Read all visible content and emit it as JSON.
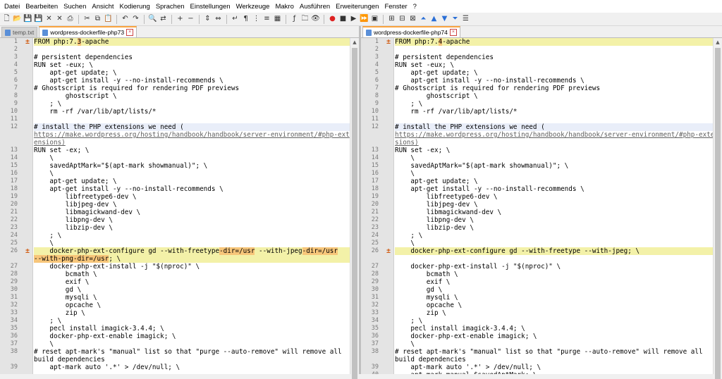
{
  "menu": [
    "Datei",
    "Bearbeiten",
    "Suchen",
    "Ansicht",
    "Kodierung",
    "Sprachen",
    "Einstellungen",
    "Werkzeuge",
    "Makro",
    "Ausführen",
    "Erweiterungen",
    "Fenster",
    "?"
  ],
  "toolbar_icons": [
    "new-file-icon",
    "open-file-icon",
    "save-icon",
    "save-all-icon",
    "close-icon",
    "close-all-icon",
    "print-icon",
    "cut-icon",
    "copy-icon",
    "paste-icon",
    "undo-icon",
    "redo-icon",
    "find-icon",
    "replace-icon",
    "zoom-in-icon",
    "zoom-out-icon",
    "sync-vertical-icon",
    "sync-horizontal-icon",
    "word-wrap-icon",
    "all-characters-icon",
    "indent-guide-icon",
    "lang-icon",
    "doc-map-icon",
    "function-list-icon",
    "folder-workspace-icon",
    "monitoring-icon",
    "record-macro-icon",
    "stop-record-icon",
    "play-macro-icon",
    "run-macro-multiple-icon",
    "save-macro-icon",
    "compare-icon",
    "compare-settings-icon",
    "clear-compare-icon",
    "first-diff-icon",
    "prev-diff-icon",
    "next-diff-icon",
    "last-diff-icon",
    "nav-bar-icon"
  ],
  "left": {
    "tabs": [
      {
        "label": "temp.txt",
        "active": false
      },
      {
        "label": "wordpress-dockerfile-php73",
        "active": true
      }
    ],
    "lines": [
      {
        "n": "1",
        "code": "FROM php:7.3-apache",
        "style": "hl",
        "mark": "+"
      },
      {
        "n": "2",
        "code": ""
      },
      {
        "n": "3",
        "code": "# persistent dependencies"
      },
      {
        "n": "4",
        "code": "RUN set -eux; \\"
      },
      {
        "n": "5",
        "code": "    apt-get update; \\"
      },
      {
        "n": "6",
        "code": "    apt-get install -y --no-install-recommends \\"
      },
      {
        "n": "7",
        "code": "# Ghostscript is required for rendering PDF previews"
      },
      {
        "n": "8",
        "code": "        ghostscript \\"
      },
      {
        "n": "9",
        "code": "    ; \\"
      },
      {
        "n": "10",
        "code": "    rm -rf /var/lib/apt/lists/*"
      },
      {
        "n": "11",
        "code": ""
      },
      {
        "n": "12",
        "code": "# install the PHP extensions we need (",
        "style": "sel"
      },
      {
        "n": "",
        "code": "https://make.wordpress.org/hosting/handbook/handbook/server-environment/#php-ext",
        "link": true
      },
      {
        "n": "",
        "code": "ensions)",
        "link": true
      },
      {
        "n": "13",
        "code": "RUN set -ex; \\"
      },
      {
        "n": "14",
        "code": "    \\"
      },
      {
        "n": "15",
        "code": "    savedAptMark=\"$(apt-mark showmanual)\"; \\"
      },
      {
        "n": "16",
        "code": "    \\"
      },
      {
        "n": "17",
        "code": "    apt-get update; \\"
      },
      {
        "n": "18",
        "code": "    apt-get install -y --no-install-recommends \\"
      },
      {
        "n": "19",
        "code": "        libfreetype6-dev \\"
      },
      {
        "n": "20",
        "code": "        libjpeg-dev \\"
      },
      {
        "n": "21",
        "code": "        libmagickwand-dev \\"
      },
      {
        "n": "22",
        "code": "        libpng-dev \\"
      },
      {
        "n": "23",
        "code": "        libzip-dev \\"
      },
      {
        "n": "24",
        "code": "    ; \\"
      },
      {
        "n": "25",
        "code": "    \\"
      },
      {
        "n": "26",
        "code": "    docker-php-ext-configure gd --with-freetype-dir=/usr --with-jpeg-dir=/usr",
        "style": "hl",
        "mark": "+"
      },
      {
        "n": "",
        "code": "--with-png-dir=/usr; \\",
        "style": "hl"
      },
      {
        "n": "27",
        "code": "    docker-php-ext-install -j \"$(nproc)\" \\"
      },
      {
        "n": "28",
        "code": "        bcmath \\"
      },
      {
        "n": "29",
        "code": "        exif \\"
      },
      {
        "n": "30",
        "code": "        gd \\"
      },
      {
        "n": "31",
        "code": "        mysqli \\"
      },
      {
        "n": "32",
        "code": "        opcache \\"
      },
      {
        "n": "33",
        "code": "        zip \\"
      },
      {
        "n": "34",
        "code": "    ; \\"
      },
      {
        "n": "35",
        "code": "    pecl install imagick-3.4.4; \\"
      },
      {
        "n": "36",
        "code": "    docker-php-ext-enable imagick; \\"
      },
      {
        "n": "37",
        "code": "    \\"
      },
      {
        "n": "38",
        "code": "# reset apt-mark's \"manual\" list so that \"purge --auto-remove\" will remove all"
      },
      {
        "n": "",
        "code": "build dependencies"
      },
      {
        "n": "39",
        "code": "    apt-mark auto '.*' > /dev/null; \\"
      }
    ]
  },
  "right": {
    "tabs": [
      {
        "label": "wordpress-dockerfile-php74",
        "active": true
      }
    ],
    "lines": [
      {
        "n": "1",
        "code": "FROM php:7.4-apache",
        "style": "hl",
        "mark": "+"
      },
      {
        "n": "2",
        "code": ""
      },
      {
        "n": "3",
        "code": "# persistent dependencies"
      },
      {
        "n": "4",
        "code": "RUN set -eux; \\"
      },
      {
        "n": "5",
        "code": "    apt-get update; \\"
      },
      {
        "n": "6",
        "code": "    apt-get install -y --no-install-recommends \\"
      },
      {
        "n": "7",
        "code": "# Ghostscript is required for rendering PDF previews"
      },
      {
        "n": "8",
        "code": "        ghostscript \\"
      },
      {
        "n": "9",
        "code": "    ; \\"
      },
      {
        "n": "10",
        "code": "    rm -rf /var/lib/apt/lists/*"
      },
      {
        "n": "11",
        "code": ""
      },
      {
        "n": "12",
        "code": "# install the PHP extensions we need (",
        "style": "sel"
      },
      {
        "n": "",
        "code": "https://make.wordpress.org/hosting/handbook/handbook/server-environment/#php-exten",
        "link": true
      },
      {
        "n": "",
        "code": "sions)",
        "link": true
      },
      {
        "n": "13",
        "code": "RUN set -ex; \\"
      },
      {
        "n": "14",
        "code": "    \\"
      },
      {
        "n": "15",
        "code": "    savedAptMark=\"$(apt-mark showmanual)\"; \\"
      },
      {
        "n": "16",
        "code": "    \\"
      },
      {
        "n": "17",
        "code": "    apt-get update; \\"
      },
      {
        "n": "18",
        "code": "    apt-get install -y --no-install-recommends \\"
      },
      {
        "n": "19",
        "code": "        libfreetype6-dev \\"
      },
      {
        "n": "20",
        "code": "        libjpeg-dev \\"
      },
      {
        "n": "21",
        "code": "        libmagickwand-dev \\"
      },
      {
        "n": "22",
        "code": "        libpng-dev \\"
      },
      {
        "n": "23",
        "code": "        libzip-dev \\"
      },
      {
        "n": "24",
        "code": "    ; \\"
      },
      {
        "n": "25",
        "code": "    \\"
      },
      {
        "n": "26",
        "code": "    docker-php-ext-configure gd --with-freetype --with-jpeg; \\",
        "style": "hl",
        "mark": "+"
      },
      {
        "n": "",
        "code": "",
        "style": "blank"
      },
      {
        "n": "27",
        "code": "    docker-php-ext-install -j \"$(nproc)\" \\"
      },
      {
        "n": "28",
        "code": "        bcmath \\"
      },
      {
        "n": "29",
        "code": "        exif \\"
      },
      {
        "n": "30",
        "code": "        gd \\"
      },
      {
        "n": "31",
        "code": "        mysqli \\"
      },
      {
        "n": "32",
        "code": "        opcache \\"
      },
      {
        "n": "33",
        "code": "        zip \\"
      },
      {
        "n": "34",
        "code": "    ; \\"
      },
      {
        "n": "35",
        "code": "    pecl install imagick-3.4.4; \\"
      },
      {
        "n": "36",
        "code": "    docker-php-ext-enable imagick; \\"
      },
      {
        "n": "37",
        "code": "    \\"
      },
      {
        "n": "38",
        "code": "# reset apt-mark's \"manual\" list so that \"purge --auto-remove\" will remove all"
      },
      {
        "n": "",
        "code": "build dependencies"
      },
      {
        "n": "39",
        "code": "    apt-mark auto '.*' > /dev/null; \\"
      },
      {
        "n": "40",
        "code": "    apt-mark manual $savedAptMark; \\"
      }
    ]
  },
  "colors": {
    "diff_highlight": "#f3f1a8",
    "diff_char": "#f7c67a",
    "tab_accent": "#f9a33f",
    "change_marker": "#d05a10"
  }
}
